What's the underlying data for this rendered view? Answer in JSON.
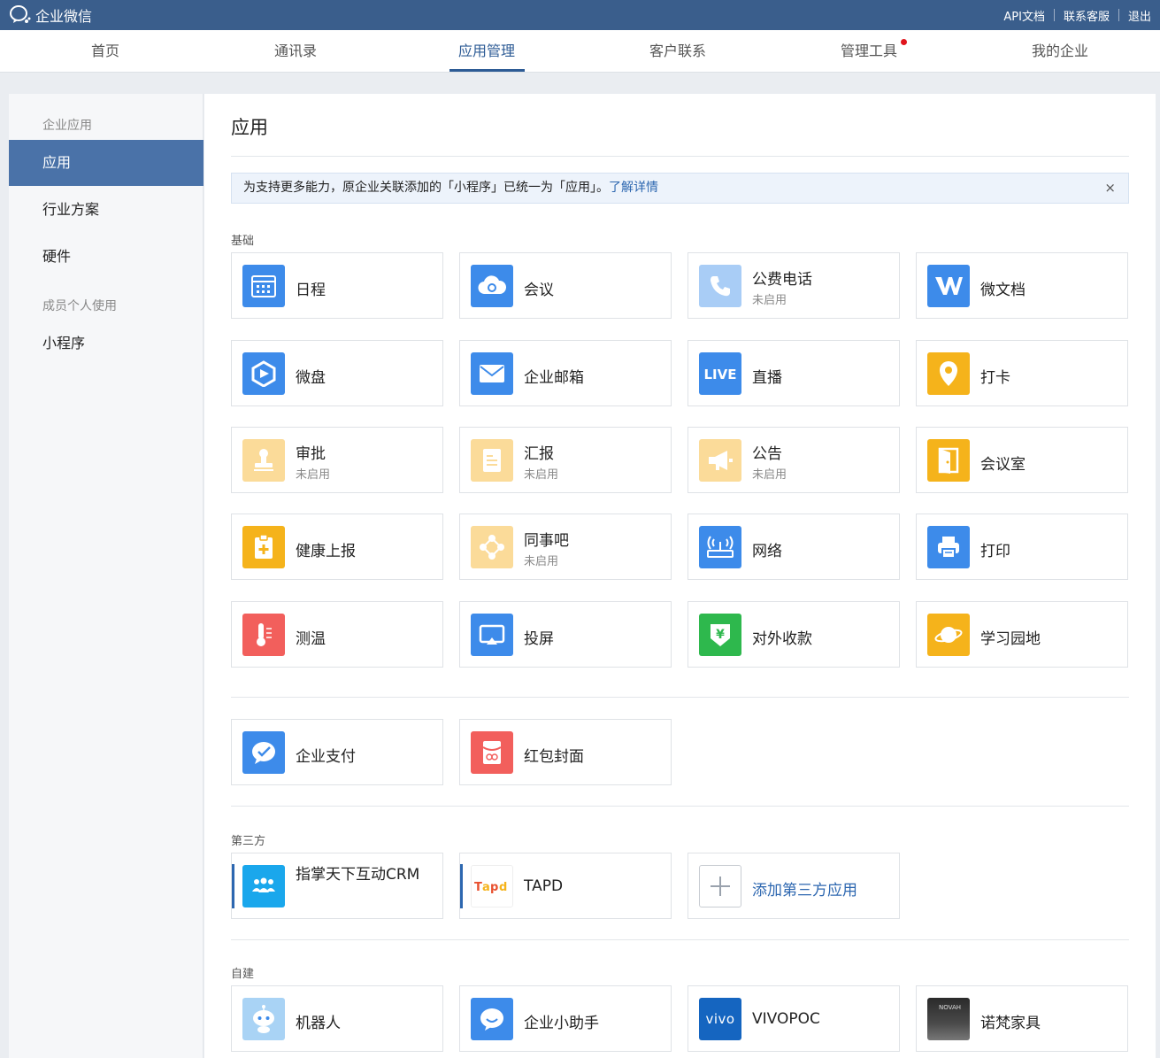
{
  "app": {
    "logo_text": "企业微信"
  },
  "header": {
    "links": [
      "API文档",
      "联系客服",
      "退出"
    ]
  },
  "nav": {
    "tabs": [
      {
        "label": "首页"
      },
      {
        "label": "通讯录"
      },
      {
        "label": "应用管理",
        "active": true
      },
      {
        "label": "客户联系"
      },
      {
        "label": "管理工具",
        "badge": "red-dot"
      },
      {
        "label": "我的企业"
      }
    ]
  },
  "sidebar": {
    "group1": "企业应用",
    "items1": [
      "应用",
      "行业方案",
      "硬件"
    ],
    "group2": "成员个人使用",
    "items2": [
      "小程序"
    ]
  },
  "main": {
    "title": "应用",
    "notice": {
      "text": "为支持更多能力，原企业关联添加的「小程序」已统一为「应用」。",
      "link": "了解详情",
      "close": "×"
    },
    "sections": {
      "basic": "基础",
      "third": "第三方",
      "custom": "自建"
    },
    "status_disabled": "未启用",
    "basic_apps": [
      {
        "name": "日程",
        "icon": "calendar-icon",
        "color": "#3d8bea"
      },
      {
        "name": "会议",
        "icon": "cloud-meeting-icon",
        "color": "#3d8bea"
      },
      {
        "name": "公费电话",
        "icon": "phone-icon",
        "color": "#a9cdf6",
        "disabled": true
      },
      {
        "name": "微文档",
        "icon": "doc-w-icon",
        "color": "#3d8bea"
      },
      {
        "name": "微盘",
        "icon": "drive-icon",
        "color": "#3d8bea"
      },
      {
        "name": "企业邮箱",
        "icon": "mail-icon",
        "color": "#3d8bea"
      },
      {
        "name": "直播",
        "icon": "live-icon",
        "color": "#3d8bea"
      },
      {
        "name": "打卡",
        "icon": "location-pin-icon",
        "color": "#f5b31b"
      },
      {
        "name": "审批",
        "icon": "stamp-icon",
        "color": "#fbdb99",
        "disabled": true
      },
      {
        "name": "汇报",
        "icon": "report-icon",
        "color": "#fbdb99",
        "disabled": true
      },
      {
        "name": "公告",
        "icon": "megaphone-icon",
        "color": "#fbdb99",
        "disabled": true
      },
      {
        "name": "会议室",
        "icon": "door-icon",
        "color": "#f5b31b"
      },
      {
        "name": "健康上报",
        "icon": "clipboard-plus-icon",
        "color": "#f5b31b"
      },
      {
        "name": "同事吧",
        "icon": "network-icon",
        "color": "#fbdb99",
        "disabled": true
      },
      {
        "name": "网络",
        "icon": "router-icon",
        "color": "#3d8bea"
      },
      {
        "name": "打印",
        "icon": "printer-icon",
        "color": "#3d8bea"
      },
      {
        "name": "测温",
        "icon": "thermometer-icon",
        "color": "#f25f5c"
      },
      {
        "name": "投屏",
        "icon": "screencast-icon",
        "color": "#3d8bea"
      },
      {
        "name": "对外收款",
        "icon": "yuan-shield-icon",
        "color": "#2eb84d"
      },
      {
        "name": "学习园地",
        "icon": "planet-icon",
        "color": "#f5b31b"
      }
    ],
    "extra_apps": [
      {
        "name": "企业支付",
        "icon": "pay-bubble-icon",
        "color": "#3d8bea"
      },
      {
        "name": "红包封面",
        "icon": "red-packet-icon",
        "color": "#f25f5c"
      }
    ],
    "third_apps": [
      {
        "name": "指掌天下互动CRM",
        "icon": "crm-people-icon",
        "color": "#1aa7ec"
      },
      {
        "name": "TAPD",
        "icon": "tapd-logo-icon",
        "color": "#ffffff"
      },
      {
        "name": "添加第三方应用",
        "icon": "plus-icon",
        "color": "#ffffff"
      }
    ],
    "custom_apps": [
      {
        "name": "机器人",
        "icon": "robot-icon",
        "color": "#a9d3f5"
      },
      {
        "name": "企业小助手",
        "icon": "chat-bubble-icon",
        "color": "#3d8bea"
      },
      {
        "name": "VIVOPOC",
        "icon": "vivo-logo-icon",
        "color": "#1565c0",
        "logo_text": "vivo"
      },
      {
        "name": "诺梵家具",
        "icon": "novah-logo-icon",
        "color": "#333333",
        "logo_text": "NOVAH"
      }
    ]
  }
}
